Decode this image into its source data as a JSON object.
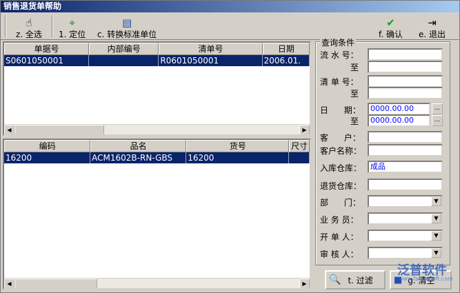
{
  "window": {
    "title": "销售退货单帮助"
  },
  "toolbar": {
    "select_all": "z. 全选",
    "locate": "1. 定位",
    "convert_unit": "c. 转换标准单位",
    "confirm": "f. 确认",
    "exit": "e. 退出"
  },
  "top_grid": {
    "headers": [
      "单据号",
      "内部编号",
      "清单号",
      "日期"
    ],
    "rows": [
      [
        "S0601050001",
        "",
        "R0601050001",
        "2006.01."
      ]
    ]
  },
  "bottom_grid": {
    "headers": [
      "编码",
      "品名",
      "货号",
      "尺寸"
    ],
    "rows": [
      [
        "16200",
        "ACM1602B-RN-GBS",
        "16200",
        ""
      ]
    ]
  },
  "query": {
    "legend": "查询条件",
    "serial_no_label": "流 水 号：",
    "serial_to_label": "至",
    "list_no_label": "清 单 号：",
    "list_to_label": "至",
    "date_label": "日      期：",
    "date_from": "0000.00.00",
    "date_to_label": "至",
    "date_to": "0000.00.00",
    "customer_label": "客      户：",
    "customer_name_label": "客户名称：",
    "in_warehouse_label": "入库仓库：",
    "in_warehouse_value": "成品",
    "return_warehouse_label": "退货仓库：",
    "department_label": "部      门：",
    "salesman_label": "业 务 员：",
    "issuer_label": "开 单 人：",
    "auditor_label": "审 核 人：",
    "dots": "..."
  },
  "bottom_buttons": {
    "filter": "t. 过滤",
    "clear": "g. 清空"
  },
  "watermark": {
    "name": "泛普软件",
    "url": "www.fanpusoft.com"
  },
  "colors": {
    "selection": "#0a246a",
    "title_start": "#0a246a",
    "title_end": "#a6caf0",
    "input_text": "#0000ff"
  }
}
